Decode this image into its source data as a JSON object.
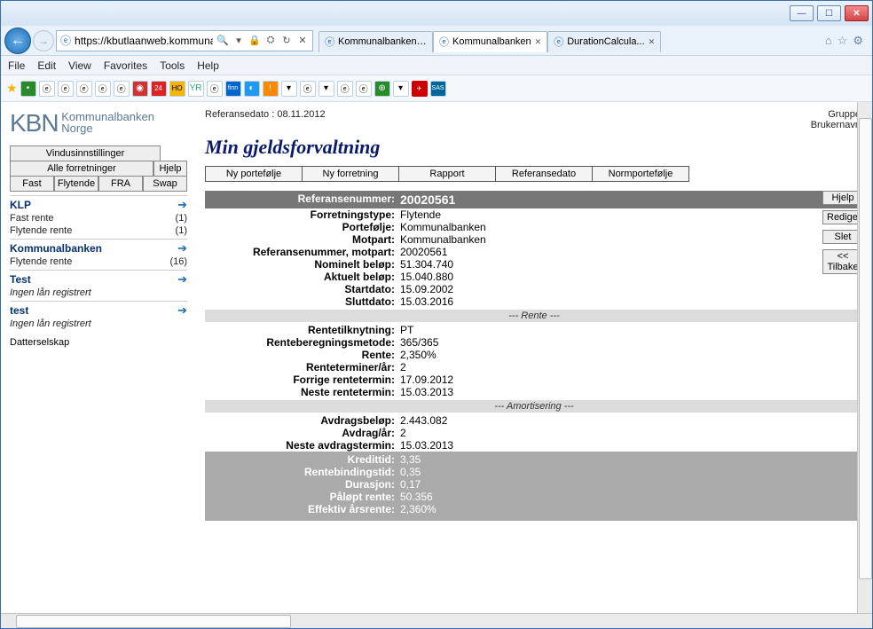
{
  "browser": {
    "url": "https://kbutlaanweb.kommunalbanken.no/",
    "menus": [
      "File",
      "Edit",
      "View",
      "Favorites",
      "Tools",
      "Help"
    ],
    "tabs": [
      {
        "label": "Kommunalbanken ...",
        "active": false,
        "closable": false
      },
      {
        "label": "Kommunalbanken",
        "active": true,
        "closable": true
      },
      {
        "label": "DurationCalcula...",
        "active": false,
        "closable": true
      }
    ]
  },
  "logo": {
    "brand": "KBN",
    "line1": "Kommunalbanken",
    "line2": "Norge"
  },
  "side": {
    "vindus": "Vindusinnstillinger",
    "alle": "Alle forretninger",
    "hjelp": "Hjelp",
    "tabs": [
      "Fast",
      "Flytende",
      "FRA",
      "Swap"
    ],
    "sections": [
      {
        "name": "KLP",
        "lines": [
          {
            "t": "Fast rente",
            "c": "(1)"
          },
          {
            "t": "Flytende rente",
            "c": "(1)"
          }
        ]
      },
      {
        "name": "Kommunalbanken",
        "lines": [
          {
            "t": "Flytende rente",
            "c": "(16)"
          }
        ]
      },
      {
        "name": "Test",
        "lines": [
          {
            "t": "Ingen lån registrert",
            "c": ""
          }
        ],
        "italic": true
      },
      {
        "name": "test",
        "lines": [
          {
            "t": "Ingen lån registrert",
            "c": ""
          }
        ],
        "italic": true
      }
    ],
    "datter": "Datterselskap"
  },
  "main": {
    "refdato_label": "Referansedato :",
    "refdato": "08.11.2012",
    "gruppe": "Gruppe:",
    "bruker": "Brukernavn:",
    "title": "Min gjeldsforvaltning",
    "buttons": [
      "Ny portefølje",
      "Ny forretning",
      "Rapport",
      "Referansedato",
      "Normportefølje"
    ],
    "right_buttons": [
      "Hjelp",
      "Redigere",
      "Slet",
      "<< Tilbake"
    ],
    "header": {
      "lab": "Referansenummer:",
      "val": "20020561"
    },
    "rows1": [
      {
        "lab": "Forretningstype:",
        "val": "Flytende"
      },
      {
        "lab": "Portefølje:",
        "val": "Kommunalbanken"
      },
      {
        "lab": "Motpart:",
        "val": "Kommunalbanken"
      },
      {
        "lab": "Referansenummer, motpart:",
        "val": "20020561"
      },
      {
        "lab": "Nominelt beløp:",
        "val": "51.304.740"
      },
      {
        "lab": "Aktuelt beløp:",
        "val": "15.040.880"
      },
      {
        "lab": "Startdato:",
        "val": "15.09.2002"
      },
      {
        "lab": "Sluttdato:",
        "val": "15.03.2016"
      }
    ],
    "sec_rente": "--- Rente ---",
    "rows2": [
      {
        "lab": "Rentetilknytning:",
        "val": "PT"
      },
      {
        "lab": "Renteberegningsmetode:",
        "val": "365/365"
      },
      {
        "lab": "Rente:",
        "val": "2,350%"
      },
      {
        "lab": "Renteterminer/år:",
        "val": "2"
      },
      {
        "lab": "Forrige rentetermin:",
        "val": "17.09.2012"
      },
      {
        "lab": "Neste rentetermin:",
        "val": "15.03.2013"
      }
    ],
    "sec_amort": "--- Amortisering ---",
    "rows3": [
      {
        "lab": "Avdragsbeløp:",
        "val": "2.443.082"
      },
      {
        "lab": "Avdrag/år:",
        "val": "2"
      },
      {
        "lab": "Neste avdragstermin:",
        "val": "15.03.2013"
      }
    ],
    "rows_gray": [
      {
        "lab": "Kredittid:",
        "val": "3,35"
      },
      {
        "lab": "Rentebindingstid:",
        "val": "0,35"
      },
      {
        "lab": "Durasjon:",
        "val": "0,17"
      },
      {
        "lab": "Påløpt rente:",
        "val": "50.356"
      },
      {
        "lab": "Effektiv årsrente:",
        "val": "2,360%"
      }
    ]
  }
}
